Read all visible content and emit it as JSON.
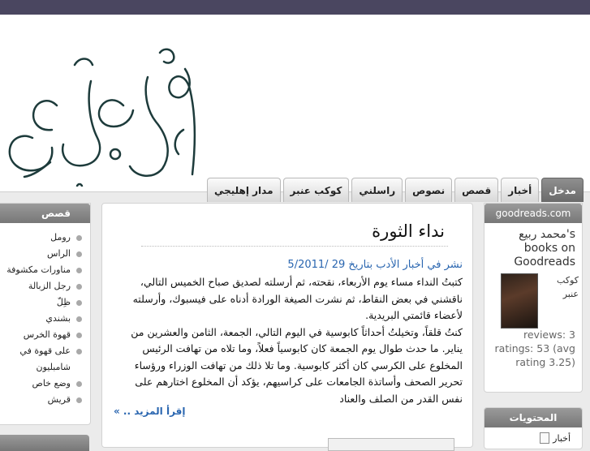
{
  "tabs": [
    {
      "label": "مدخل",
      "active": true
    },
    {
      "label": "أخبار",
      "active": false
    },
    {
      "label": "قصص",
      "active": false
    },
    {
      "label": "نصوص",
      "active": false
    },
    {
      "label": "راسلني",
      "active": false
    },
    {
      "label": "كوكب عنبر",
      "active": false
    },
    {
      "label": "مدار إهليجي",
      "active": false
    }
  ],
  "left_sidebar": {
    "title": "قصص",
    "items": [
      "رومل",
      "الراس",
      "مناورات مكشوفة",
      "رجل الزبالة",
      "ظِلّ",
      "بشندي",
      "قهوة الخرس",
      "على قهوة في شامبليون",
      "وضع خاص",
      "قريش"
    ]
  },
  "article": {
    "title": "نداء الثورة",
    "meta": "نشر في أخبار الأدب بتاريخ 29 /5/2011",
    "paragraph1": "كتبتُ النداء مساء يوم الأربعاء، نقحته، ثم أرسلته لصديق صباح الخميس التالي، ناقشني في بعض النقاط، ثم نشرت الصيغة الورادة أدناه على فيسبوك، وأرسلته لأعضاء قائمتي البريدية.",
    "paragraph2": "كنتُ قلقاً، وتخيلتُ أحداثاً كابوسية في اليوم التالي، الجمعة، الثامن والعشرين من يناير. ما حدث طوال يوم الجمعة كان كابوسياً فعلاً، وما تلاه من تهافت الرئيس المخلوع على الكرسي كان أكثر كابوسية. وما تلا ذلك من تهافت الوزراء ورؤساء تحرير الصحف وأساتذة الجامعات على كراسيهم، يؤكد أن المخلوع اختارهم على نفس القدر من الصلف والعناد",
    "read_more": "إقرأ المزيد .. »"
  },
  "goodreads": {
    "header": "goodreads.com",
    "owner_line1": "محمد ربيع's",
    "owner_line2": "books on",
    "owner_line3": "Goodreads",
    "book": "كوكب عنبر",
    "stat1": "reviews: 3",
    "stat2": "ratings: 53 (avg",
    "stat3": "rating 3.25)"
  },
  "contents_box": {
    "title": "المحتويات",
    "item": "أخبار"
  },
  "logo": {
    "text": "محمد ربيع"
  }
}
